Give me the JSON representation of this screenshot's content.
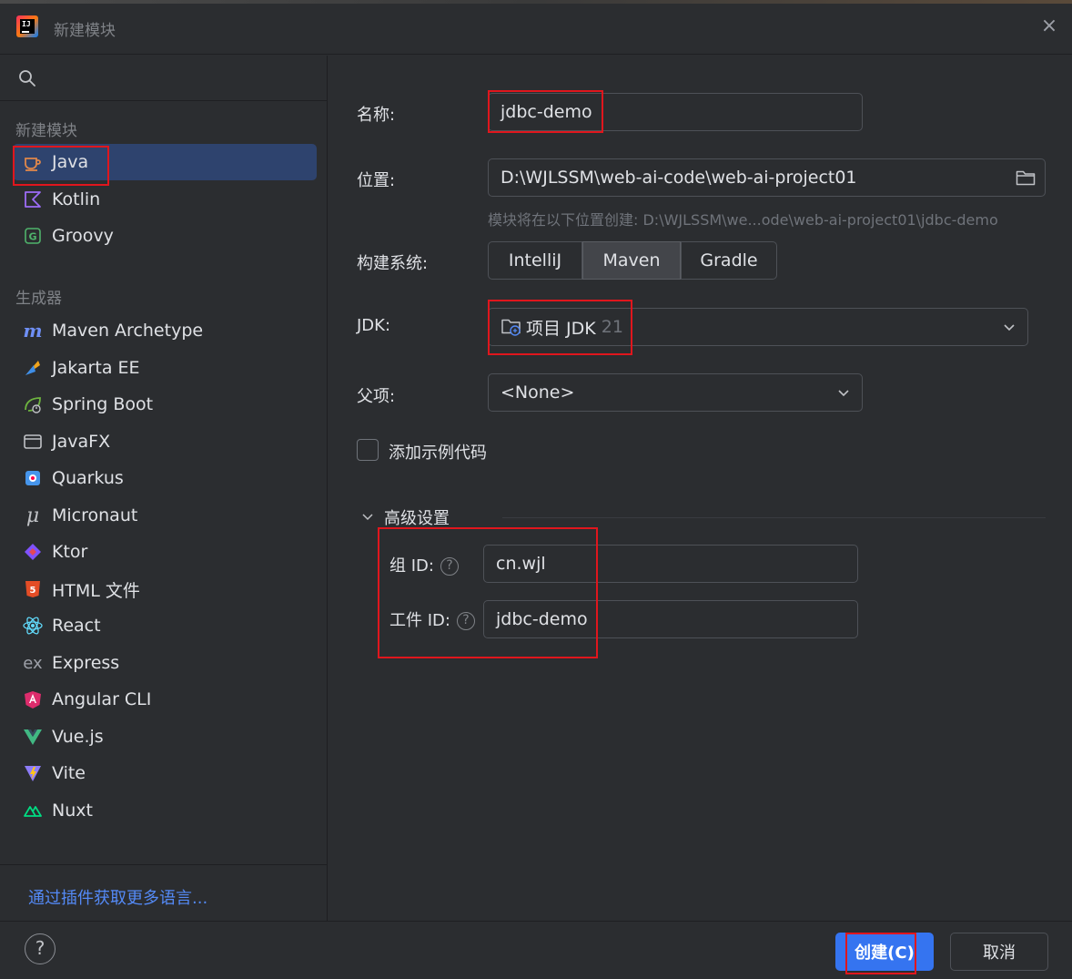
{
  "window": {
    "title": "新建模块",
    "close_icon": "×"
  },
  "sidebar": {
    "sections": [
      {
        "title": "新建模块",
        "items": [
          {
            "label": "Java",
            "icon": "java-cup-icon",
            "selected": true
          },
          {
            "label": "Kotlin",
            "icon": "kotlin-icon"
          },
          {
            "label": "Groovy",
            "icon": "groovy-icon"
          }
        ]
      },
      {
        "title": "生成器",
        "items": [
          {
            "label": "Maven Archetype",
            "icon": "maven-icon"
          },
          {
            "label": "Jakarta EE",
            "icon": "jakarta-icon"
          },
          {
            "label": "Spring Boot",
            "icon": "spring-icon"
          },
          {
            "label": "JavaFX",
            "icon": "javafx-icon"
          },
          {
            "label": "Quarkus",
            "icon": "quarkus-icon"
          },
          {
            "label": "Micronaut",
            "icon": "micronaut-icon"
          },
          {
            "label": "Ktor",
            "icon": "ktor-icon"
          },
          {
            "label": "HTML 文件",
            "icon": "html5-icon"
          },
          {
            "label": "React",
            "icon": "react-icon"
          },
          {
            "label": "Express",
            "icon": "express-icon"
          },
          {
            "label": "Angular CLI",
            "icon": "angular-icon"
          },
          {
            "label": "Vue.js",
            "icon": "vue-icon"
          },
          {
            "label": "Vite",
            "icon": "vite-icon"
          },
          {
            "label": "Nuxt",
            "icon": "nuxt-icon"
          }
        ]
      }
    ],
    "plugins_link": "通过插件获取更多语言..."
  },
  "form": {
    "name_label": "名称:",
    "name_value": "jdbc-demo",
    "location_label": "位置:",
    "location_value": "D:\\WJLSSM\\web-ai-code\\web-ai-project01",
    "location_hint": "模块将在以下位置创建: D:\\WJLSSM\\we...ode\\web-ai-project01\\jdbc-demo",
    "build_label": "构建系统:",
    "build_options": [
      "IntelliJ",
      "Maven",
      "Gradle"
    ],
    "build_selected": "Maven",
    "jdk_label": "JDK:",
    "jdk_value": "项目 JDK",
    "jdk_version": "21",
    "parent_label": "父项:",
    "parent_value": "<None>",
    "sample_code_label": "添加示例代码",
    "sample_code_checked": false,
    "advanced_label": "高级设置",
    "group_id_label": "组 ID:",
    "group_id_value": "cn.wjl",
    "artifact_id_label": "工件 ID:",
    "artifact_id_value": "jdbc-demo",
    "help_mark": "?"
  },
  "footer": {
    "help": "?",
    "create": "创建(C)",
    "cancel": "取消"
  },
  "colors": {
    "accent": "#3574f0",
    "selection": "#2e436e",
    "highlight_box": "#e0161d",
    "link": "#548af7"
  }
}
